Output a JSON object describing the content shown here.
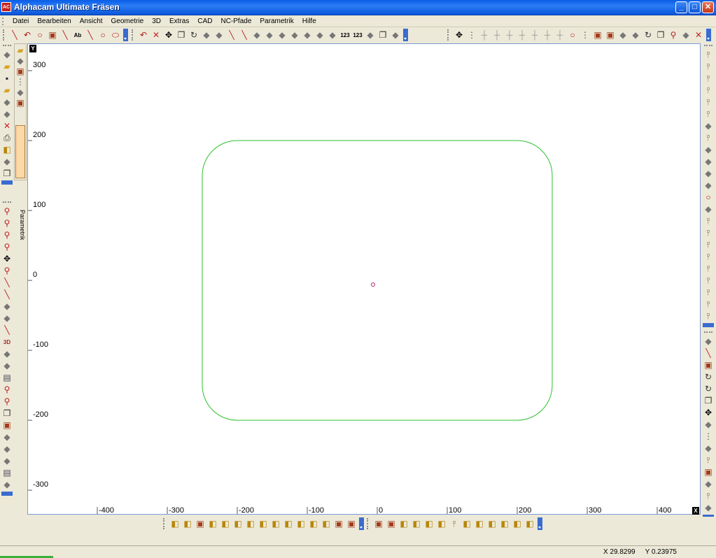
{
  "window": {
    "title": "Alphacam Ultimate Fräsen",
    "icon_text": "AC",
    "controls": {
      "minimize": "_",
      "maximize": "□",
      "close": "✕"
    }
  },
  "menu": [
    "Datei",
    "Bearbeiten",
    "Ansicht",
    "Geometrie",
    "3D",
    "Extras",
    "CAD",
    "NC-Pfade",
    "Parametrik",
    "Hilfe"
  ],
  "toolbar_top": {
    "draw_tools": [
      "polyline-icon",
      "arc-icon",
      "circle-icon",
      "rectangle-icon",
      "spline-icon",
      "text-ab-icon",
      "text-outline-icon",
      "circle-2-icon",
      "ellipse-icon"
    ],
    "edit_tools": [
      "undo-icon",
      "delete-icon",
      "move-icon",
      "copy-icon",
      "rotate-icon",
      "mirror-icon",
      "scale-icon",
      "trim-icon",
      "extend-icon",
      "break-icon",
      "join-icon",
      "fillet-icon",
      "chamfer-icon",
      "offset-icon",
      "explode-icon",
      "array-icon",
      "text-123-icon",
      "number-icon",
      "group-icon",
      "layer-icon",
      "arrange-icon"
    ],
    "snap_tools": [
      "pan-cross-icon",
      "grid-dots-icon",
      "snap-end-icon",
      "snap-mid-icon",
      "snap-center-icon",
      "snap-angle-icon",
      "snap-tangent-icon",
      "snap-perp-icon",
      "snap-parallel-icon",
      "snap-circle-icon",
      "grid-icon",
      "frame-icon",
      "frame-red-icon",
      "measure-icon",
      "dimension-icon",
      "refresh-icon",
      "window-copy-icon",
      "zoom-area-icon",
      "properties-icon",
      "close-red-icon"
    ]
  },
  "left_toolbar_1": [
    "new-file-icon",
    "open-folder-icon",
    "save-icon",
    "open-drawing-icon",
    "insert-icon",
    "output-icon",
    "delete-red-icon",
    "print-icon",
    "preview-icon",
    "export-icon",
    "layers-icon"
  ],
  "left_toolbar_2": [
    "zoom-in-icon",
    "zoom-user-icon",
    "zoom-red-icon",
    "zoom-out-icon",
    "pan-icon",
    "zoom-all-icon",
    "pen-icon",
    "pencil-icon",
    "hatch-icon",
    "step-icon",
    "line-red-icon",
    "3d-icon",
    "cog-icon",
    "dimension-diag-icon",
    "image-icon",
    "user-zoom-icon",
    "user-zoom-2-icon",
    "layers-fold-icon",
    "box-yellow-icon",
    "grip-icon",
    "grip-2-icon",
    "grip-3-icon",
    "monitor-icon",
    "shading-icon"
  ],
  "param_panel": {
    "tools": [
      "folder-icon",
      "list-icon",
      "box-icon",
      "grid-tools-icon",
      "table-icon",
      "frame-red-icon"
    ],
    "tab_label": "Parametrik"
  },
  "right_toolbar_1": [
    "probe-icon",
    "tool-down-icon",
    "mill-icon",
    "mill-2-icon",
    "mill-3-icon",
    "mill-4-icon",
    "pocket-icon",
    "drill-icon",
    "thread-icon",
    "contour-icon",
    "engrave-icon",
    "sort-icon",
    "sphere-icon",
    "clamp-icon",
    "tool-5-icon",
    "tool-6-icon",
    "tool-7-icon",
    "tool-8-icon",
    "tool-9-icon",
    "tool-10-icon",
    "3d-tool-icon",
    "tool-11-icon",
    "tool-12-icon"
  ],
  "right_toolbar_2": [
    "stock-icon",
    "pen-red-icon",
    "rect-red-icon",
    "rotate-icon",
    "refresh-icon",
    "copy-icon",
    "move-icon",
    "step-icon",
    "grid-cross-icon",
    "nc-icon",
    "probe-2-icon",
    "cube-red-icon",
    "edit-icon",
    "tool-13-icon",
    "pipe-red-icon"
  ],
  "bottom_toolbar": {
    "view_tools": [
      "view-3d-icon",
      "view-iso-icon",
      "view-frame-icon",
      "view-axes-green-icon",
      "view-axes-icon",
      "view-axes-2-icon",
      "view-top-icon",
      "view-front-icon",
      "view-right-icon",
      "view-back-icon",
      "view-left-icon",
      "view-bottom-icon",
      "view-iso-2-icon",
      "view-box-icon",
      "view-box-2-icon"
    ],
    "render_tools": [
      "render-frame-icon",
      "render-box-icon",
      "render-wire-icon",
      "render-solid-icon",
      "render-cut-icon",
      "render-sweep-icon",
      "render-tool-icon",
      "render-path-icon",
      "render-sim-icon",
      "render-stock-icon",
      "render-shade-icon",
      "render-compare-icon",
      "render-image-icon"
    ]
  },
  "canvas": {
    "y_axis_letter": "Y",
    "x_axis_letter": "X",
    "x_ticks": [
      "-400",
      "-300",
      "-200",
      "-100",
      "0",
      "100",
      "200",
      "300",
      "400"
    ],
    "y_ticks": [
      "300",
      "200",
      "100",
      "0",
      "-100",
      "-200",
      "-300"
    ],
    "colors": {
      "geometry": "#2ec02e",
      "origin_marker": "#b2206f",
      "axis_tick": "#5a5a5a"
    },
    "geometry": {
      "shape": "rounded-rectangle",
      "x_min": -250,
      "x_max": 250,
      "y_min": -200,
      "y_max": 200,
      "corner_radius": 50
    },
    "origin_marker": {
      "x": -6,
      "y": -6
    }
  },
  "status": {
    "x_coord": "X 29.8299",
    "y_coord": "Y 0.23975"
  }
}
